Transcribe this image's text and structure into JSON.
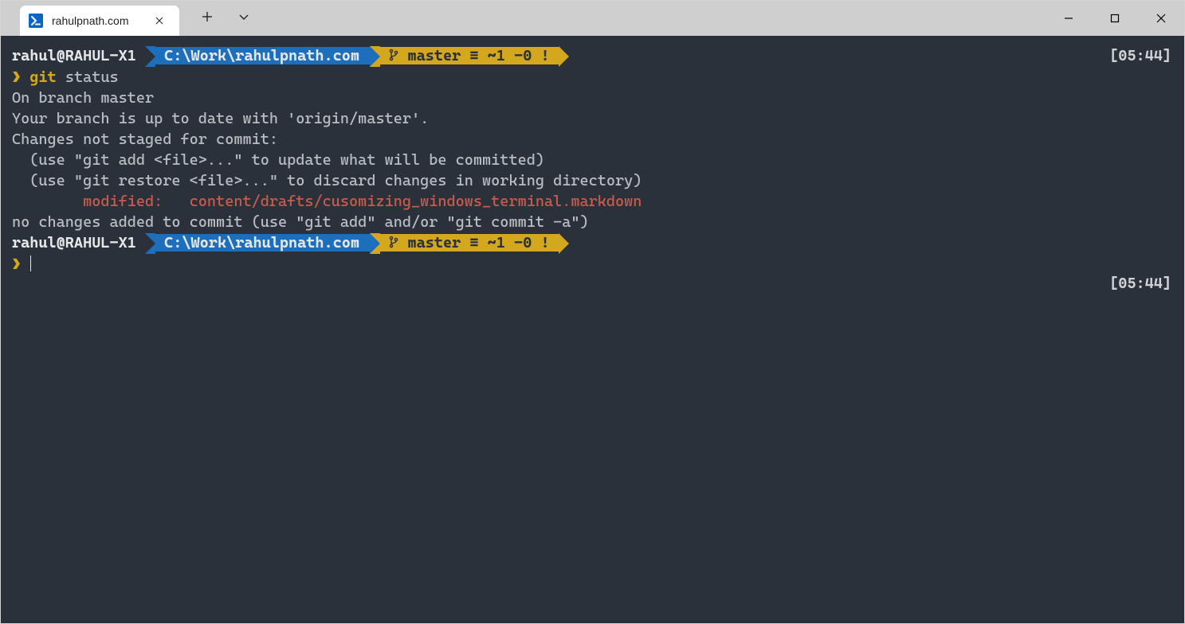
{
  "window": {
    "tab_title": "rahulpnath.com"
  },
  "prompt1": {
    "user_host": "rahul@RAHUL-X1",
    "path": "C:\\Work\\rahulpnath.com",
    "git": "master ≡ ~1 -0 !",
    "time": "[05:44]"
  },
  "prompt2": {
    "user_host": "rahul@RAHUL-X1",
    "path": "C:\\Work\\rahulpnath.com",
    "git": "master ≡ ~1 -0 !",
    "time": "[05:44]"
  },
  "cmd1": {
    "caret": "❯",
    "git_word": "git",
    "args": "status"
  },
  "output": {
    "l1": "On branch master",
    "l2": "Your branch is up to date with 'origin/master'.",
    "l3": "",
    "l4": "Changes not staged for commit:",
    "l5": "  (use \"git add <file>...\" to update what will be committed)",
    "l6": "  (use \"git restore <file>...\" to discard changes in working directory)",
    "l7": "        modified:   content/drafts/cusomizing_windows_terminal.markdown",
    "l8": "",
    "l9": "no changes added to commit (use \"git add\" and/or \"git commit -a\")"
  },
  "cmd2": {
    "caret": "❯"
  }
}
